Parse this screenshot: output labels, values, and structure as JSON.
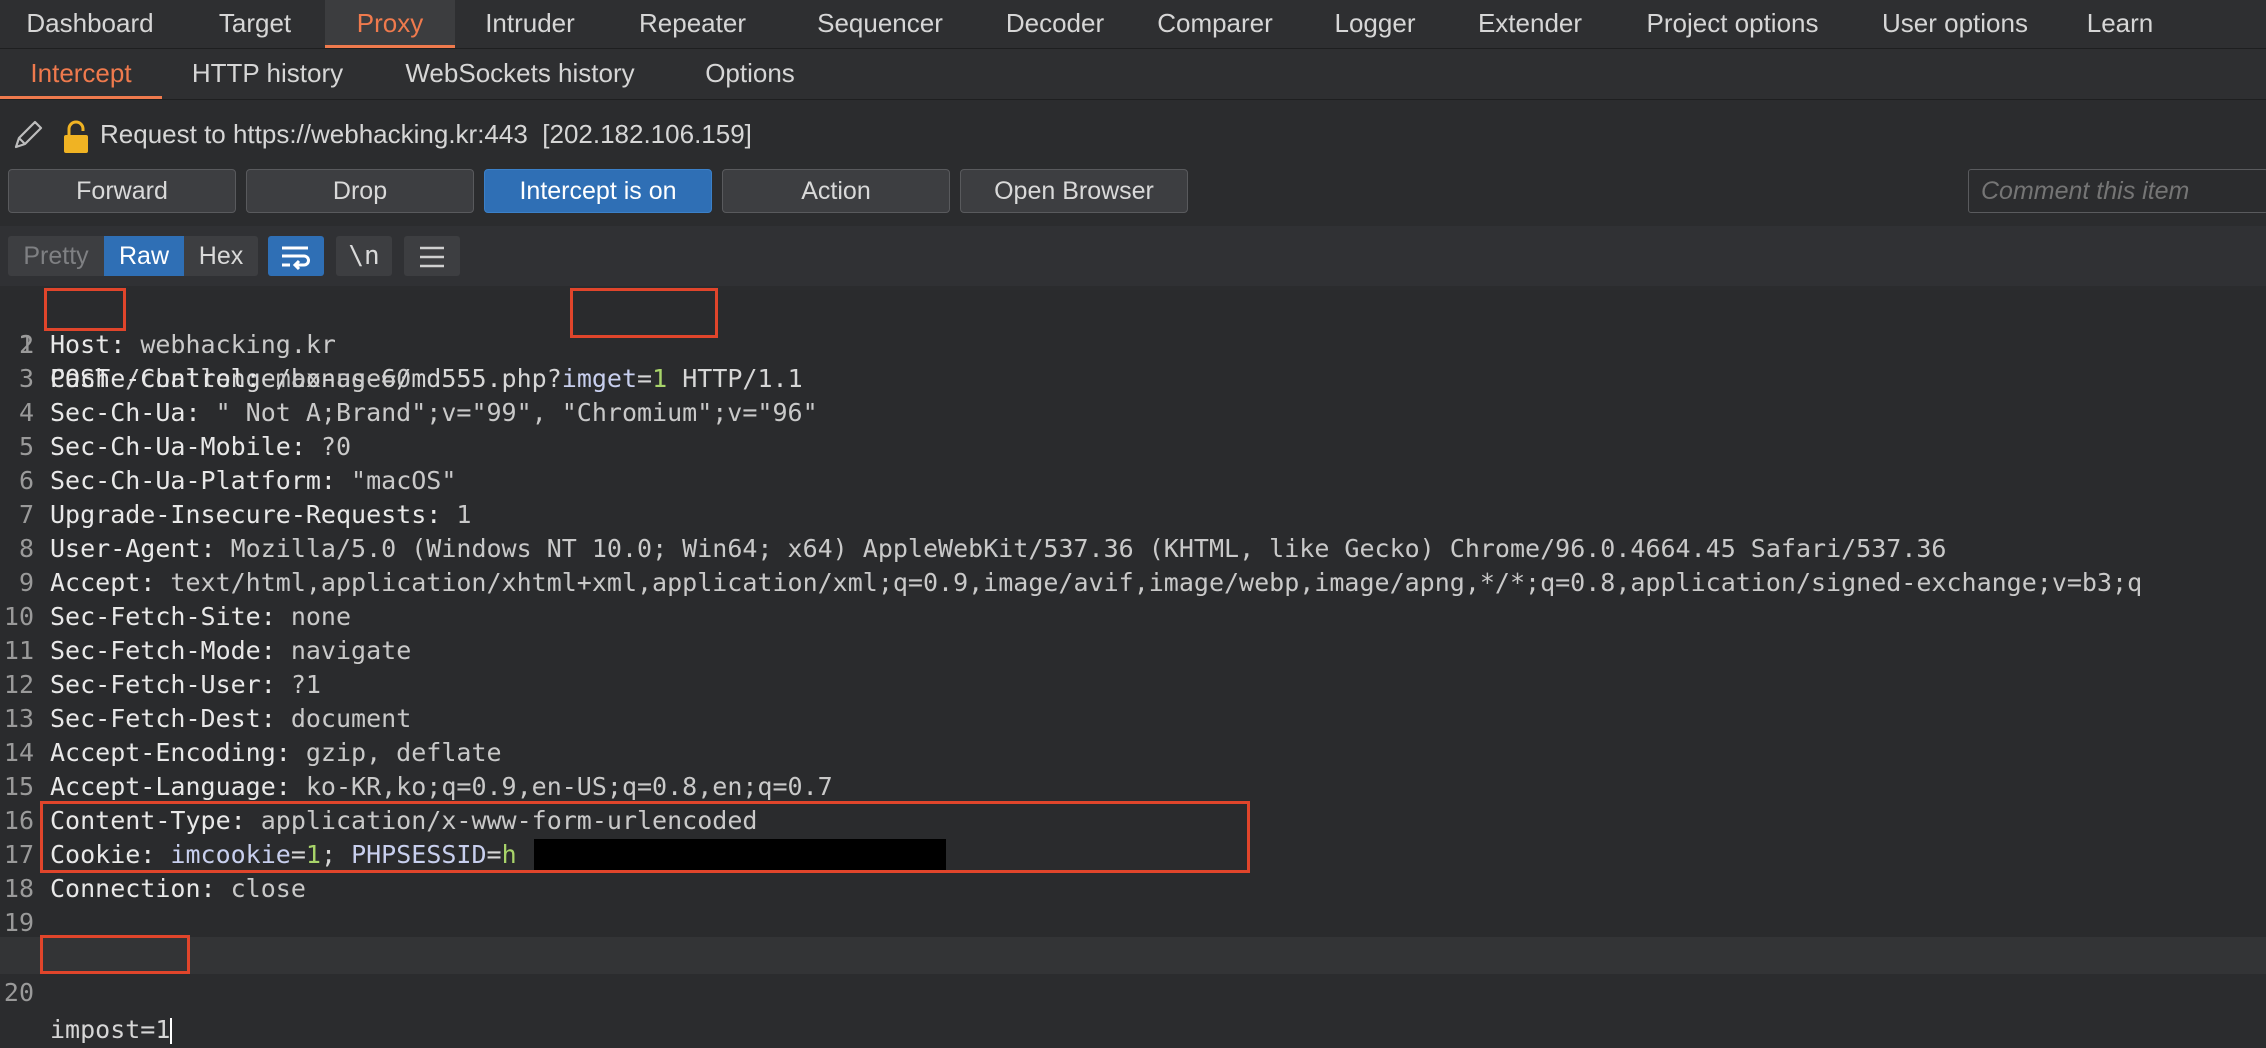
{
  "top_tabs": [
    "Dashboard",
    "Target",
    "Proxy",
    "Intruder",
    "Repeater",
    "Sequencer",
    "Decoder",
    "Comparer",
    "Logger",
    "Extender",
    "Project options",
    "User options",
    "Learn"
  ],
  "sub_tabs": [
    "Intercept",
    "HTTP history",
    "WebSockets history",
    "Options"
  ],
  "request_info": "Request to https://webhacking.kr:443  [202.182.106.159]",
  "buttons": {
    "forward": "Forward",
    "drop": "Drop",
    "intercept": "Intercept is on",
    "action": "Action",
    "open_browser": "Open Browser"
  },
  "comment_placeholder": "Comment this item",
  "view_modes": [
    "Pretty",
    "Raw",
    "Hex"
  ],
  "newline_toggle": "\\n",
  "icons": [
    "pencil-icon",
    "lock-icon",
    "wrap-icon",
    "menu-icon"
  ],
  "accent_color": "#ef7a4d",
  "primary_color": "#2f6fb5",
  "highlight_box_color": "#e0452b",
  "request": {
    "line1": {
      "method": "POST",
      "path": " /challenge/bonus-6/md555.php",
      "q": "?",
      "param": "imget",
      "eq": "=",
      "val": "1",
      "proto": " HTTP/1.1"
    },
    "host": {
      "name": "Host:",
      "value": " webhacking.kr"
    },
    "cache": {
      "name": "Cache-Control:",
      "value": " max-age=0"
    },
    "ch_ua": {
      "name": "Sec-Ch-Ua:",
      "value": " \" Not A;Brand\";v=\"99\", \"Chromium\";v=\"96\""
    },
    "ch_ua_mobile": {
      "name": "Sec-Ch-Ua-Mobile:",
      "value": " ?0"
    },
    "ch_ua_platform": {
      "name": "Sec-Ch-Ua-Platform:",
      "value": " \"macOS\""
    },
    "upgrade": {
      "name": "Upgrade-Insecure-Requests:",
      "value": " 1"
    },
    "ua": {
      "name": "User-Agent:",
      "value": " Mozilla/5.0 (Windows NT 10.0; Win64; x64) AppleWebKit/537.36 (KHTML, like Gecko) Chrome/96.0.4664.45 Safari/537.36"
    },
    "accept": {
      "name": "Accept:",
      "value": " text/html,application/xhtml+xml,application/xml;q=0.9,image/avif,image/webp,image/apng,*/*;q=0.8,application/signed-exchange;v=b3;q"
    },
    "fetch_site": {
      "name": "Sec-Fetch-Site:",
      "value": " none"
    },
    "fetch_mode": {
      "name": "Sec-Fetch-Mode:",
      "value": " navigate"
    },
    "fetch_user": {
      "name": "Sec-Fetch-User:",
      "value": " ?1"
    },
    "fetch_dest": {
      "name": "Sec-Fetch-Dest:",
      "value": " document"
    },
    "accept_enc": {
      "name": "Accept-Encoding:",
      "value": " gzip, deflate"
    },
    "accept_lang": {
      "name": "Accept-Language:",
      "value": " ko-KR,ko;q=0.9,en-US;q=0.8,en;q=0.7"
    },
    "content_type": {
      "name": "Content-Type:",
      "value": " application/x-www-form-urlencoded"
    },
    "cookie": {
      "name": "Cookie:",
      "sp": " ",
      "p1": "imcookie",
      "eq1": "=",
      "v1": "1",
      "sep": "; ",
      "p2": "PHPSESSID",
      "eq2": "=",
      "v2": "h"
    },
    "connection": {
      "name": "Connection:",
      "value": " close"
    },
    "body": "impost=1"
  },
  "line_numbers": [
    "1",
    "2",
    "3",
    "4",
    "5",
    "6",
    "7",
    "8",
    "9",
    "10",
    "11",
    "12",
    "13",
    "14",
    "15",
    "16",
    "17",
    "18",
    "19",
    "20"
  ]
}
